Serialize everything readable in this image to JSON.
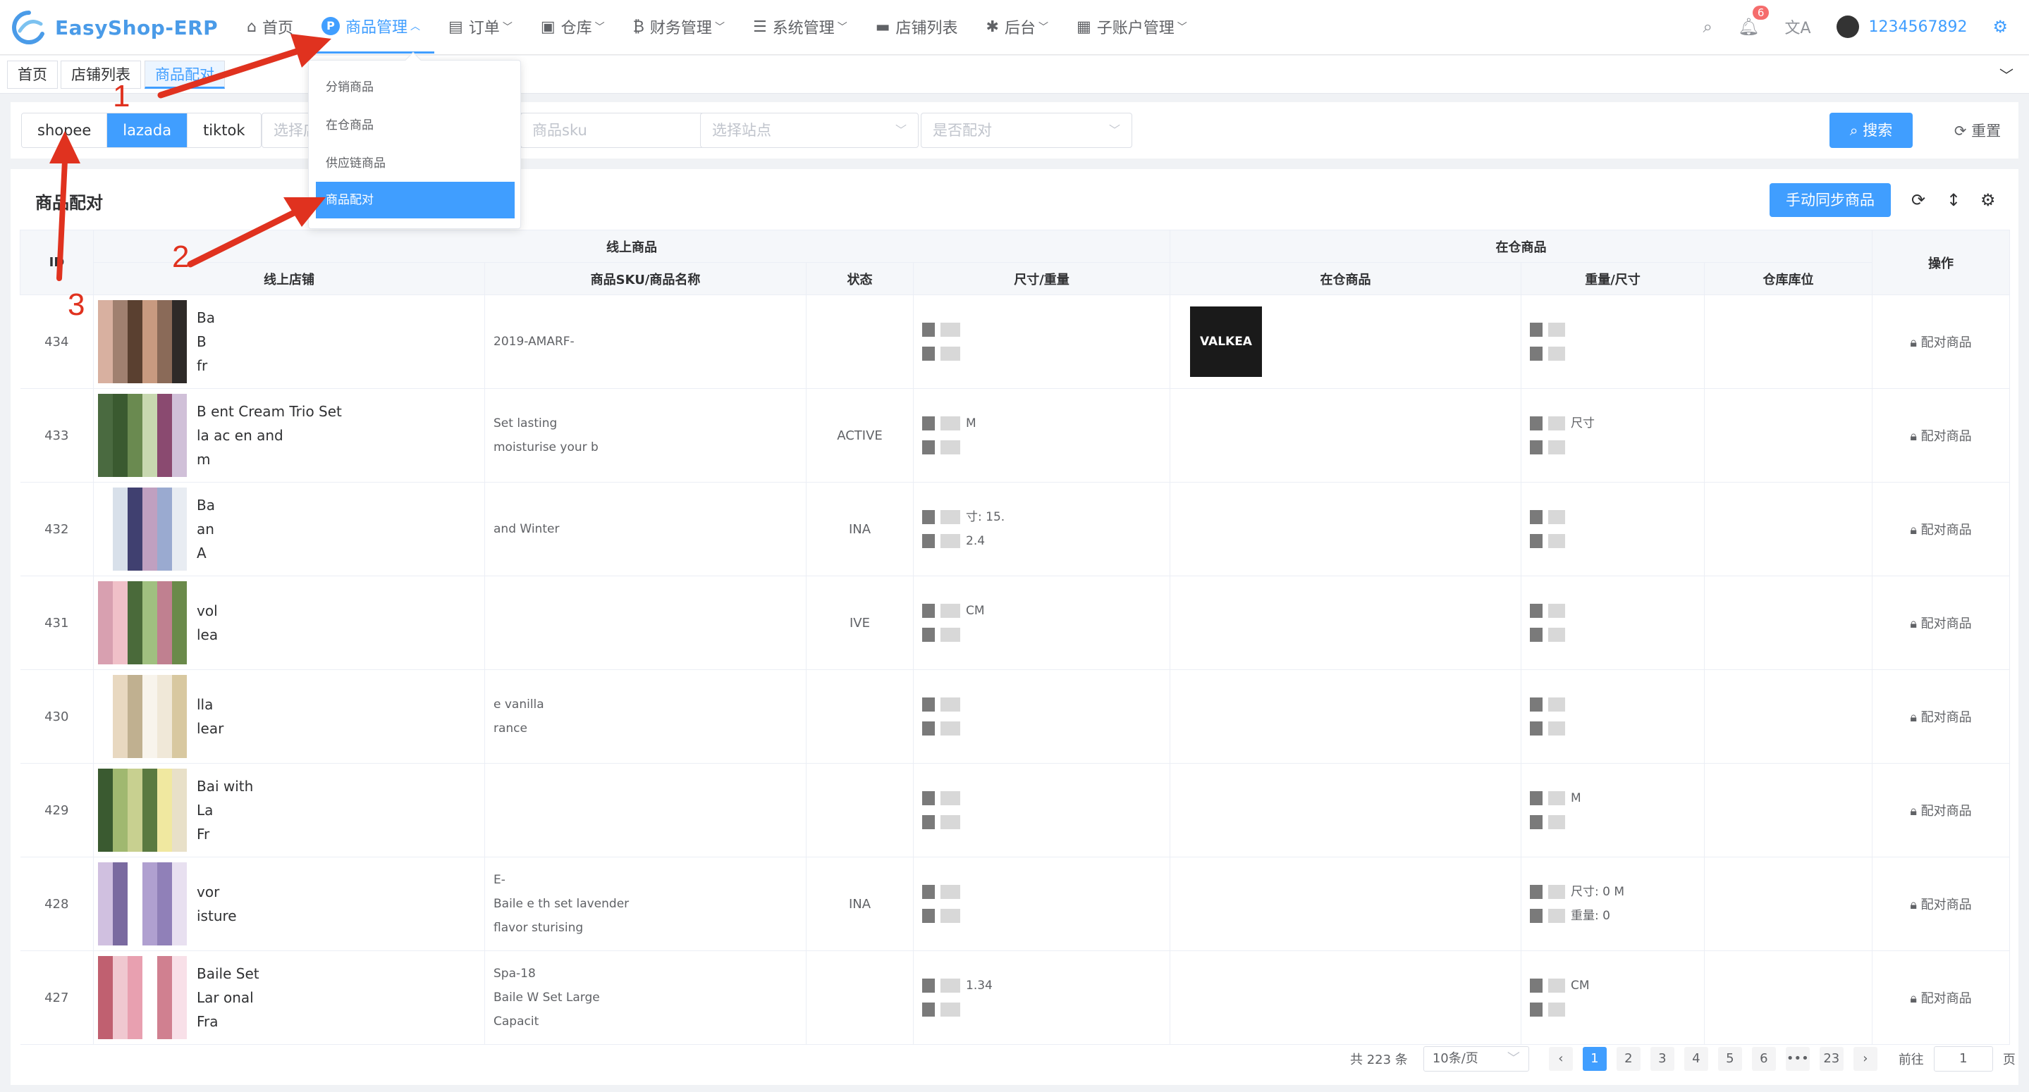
{
  "app": {
    "name": "EasyShop-ERP"
  },
  "nav": {
    "items": [
      {
        "label": "首页",
        "icon": "home-icon"
      },
      {
        "label": "商品管理",
        "icon": "product-p-icon"
      },
      {
        "label": "订单",
        "icon": "order-icon"
      },
      {
        "label": "仓库",
        "icon": "warehouse-icon"
      },
      {
        "label": "财务管理",
        "icon": "finance-icon"
      },
      {
        "label": "系统管理",
        "icon": "settings-sliders-icon"
      },
      {
        "label": "店铺列表",
        "icon": "shop-icon"
      },
      {
        "label": "后台",
        "icon": "bug-icon"
      },
      {
        "label": "子账户管理",
        "icon": "sub-account-icon"
      }
    ]
  },
  "topright": {
    "notification_count": "6",
    "username": "1234567892"
  },
  "tabs": [
    "首页",
    "店铺列表",
    "商品配对"
  ],
  "filter": {
    "platforms": [
      "shopee",
      "lazada",
      "tiktok"
    ],
    "active_platform": "lazada",
    "shop_placeholder": "选择店",
    "sku_placeholder": "商品sku",
    "site_placeholder": "选择站点",
    "paired_placeholder": "是否配对",
    "search_label": "搜索",
    "reset_label": "重置"
  },
  "dropdown": {
    "items": [
      "分销商品",
      "在仓商品",
      "供应链商品",
      "商品配对"
    ],
    "active": "商品配对"
  },
  "card": {
    "title": "商品配对",
    "sync_button": "手动同步商品"
  },
  "table": {
    "group_online": "线上商品",
    "group_warehouse": "在仓商品",
    "col_id": "ID",
    "col_shop": "线上店铺",
    "col_sku": "商品SKU/商品名称",
    "col_status": "状态",
    "col_spec": "尺寸/重量",
    "col_wh_product": "在仓商品",
    "col_weight": "重量/尺寸",
    "col_location": "仓库库位",
    "col_action": "操作",
    "action_label": "配对商品",
    "rows": [
      {
        "id": "434",
        "name": [
          "Ba",
          "B",
          "fr"
        ],
        "sku": [
          "2019-AMARF-",
          "",
          ""
        ],
        "status": "",
        "spec": [
          "",
          ""
        ],
        "wh": "VALKEA",
        "weight": [
          "",
          ""
        ]
      },
      {
        "id": "433",
        "name": [
          "B         ent         Cream Trio Set",
          "la              ac                   en and",
          "m"
        ],
        "sku": [
          "",
          "Set lasting",
          "moisturise your b"
        ],
        "status": "ACTIVE",
        "spec": [
          "M",
          ""
        ],
        "wh": "",
        "weight": [
          "尺寸",
          ""
        ]
      },
      {
        "id": "432",
        "name": [
          "Ba",
          "an",
          "A"
        ],
        "sku": [
          "",
          "",
          "and Winter"
        ],
        "status": "INA",
        "spec": [
          "寸: 15.",
          "2.4"
        ],
        "wh": "",
        "weight": [
          "",
          ""
        ]
      },
      {
        "id": "431",
        "name": [
          "",
          "vol",
          "lea"
        ],
        "sku": [
          "",
          "",
          ""
        ],
        "status": "IVE",
        "spec": [
          "CM",
          ""
        ],
        "wh": "",
        "weight": [
          "",
          ""
        ]
      },
      {
        "id": "430",
        "name": [
          "",
          "lla",
          "lear"
        ],
        "sku": [
          "",
          "e vanilla",
          "rance"
        ],
        "status": "",
        "spec": [
          "",
          ""
        ],
        "wh": "",
        "weight": [
          "",
          ""
        ]
      },
      {
        "id": "429",
        "name": [
          "Bai                                        with",
          "La",
          "Fr"
        ],
        "sku": [
          "",
          "",
          ""
        ],
        "status": "",
        "spec": [
          "",
          ""
        ],
        "wh": "",
        "weight": [
          "M",
          ""
        ]
      },
      {
        "id": "428",
        "name": [
          "",
          "vor",
          "isture"
        ],
        "sku": [
          "E-",
          "Baile         e th    set lavender",
          "flavor              sturising"
        ],
        "status": "INA",
        "spec": [
          "",
          ""
        ],
        "wh": "",
        "weight": [
          "尺寸: 0       M",
          "重量: 0"
        ]
      },
      {
        "id": "427",
        "name": [
          "Baile                                      Set",
          "Lar                                      onal",
          "Fra"
        ],
        "sku": [
          "Spa-18",
          "Baile W                  Set Large",
          "Capacit"
        ],
        "status": "",
        "spec": [
          "1.34",
          ""
        ],
        "wh": "",
        "weight": [
          "CM",
          ""
        ]
      }
    ]
  },
  "pager": {
    "total": "共 223 条",
    "page_size": "10条/页",
    "pages": [
      "1",
      "2",
      "3",
      "4",
      "5",
      "6",
      "•••",
      "23"
    ],
    "goto_label": "前往",
    "goto_value": "1",
    "page_suffix": "页"
  },
  "annotations": [
    "1",
    "2",
    "3"
  ]
}
